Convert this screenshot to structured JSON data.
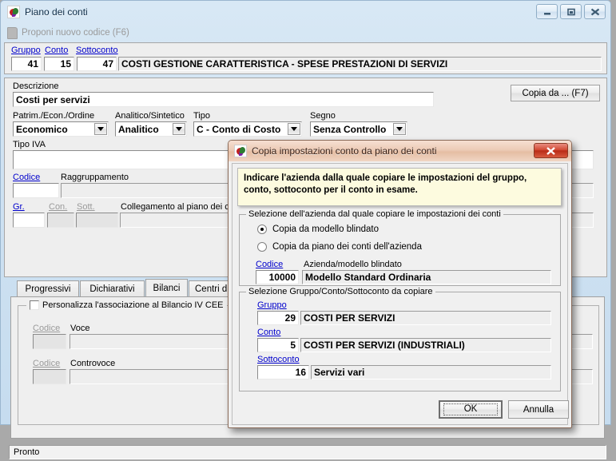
{
  "main_window": {
    "title": "Piano dei conti",
    "icon": "app-icon",
    "window_buttons": {
      "minimize": "minimize-icon",
      "maximize": "maximize-icon",
      "close": "close-icon"
    },
    "toolbar": {
      "new_code_label": "Proponi nuovo codice (F6)",
      "doc_icon": "document-icon"
    },
    "key_panel": {
      "gruppo_label": "Gruppo",
      "conto_label": "Conto",
      "sottoconto_label": "Sottoconto",
      "gruppo_value": "41",
      "conto_value": "15",
      "sottoconto_value": "47",
      "account_name": "COSTI GESTIONE CARATTERISTICA - SPESE PRESTAZIONI DI SERVIZI"
    },
    "description_panel": {
      "descrizione_label": "Descrizione",
      "descrizione_value": "Costi per servizi",
      "copia_button": "Copia da ... (F7)",
      "patrim_label": "Patrim./Econ./Ordine",
      "patrim_value": "Economico",
      "analitico_label": "Analitico/Sintetico",
      "analitico_value": "Analitico",
      "tipo_label": "Tipo",
      "tipo_value": "C - Conto di Costo",
      "segno_label": "Segno",
      "segno_value": "Senza Controllo",
      "tipo_iva_label": "Tipo IVA",
      "tipo_iva_value": "",
      "codice_label": "Codice",
      "codice_value": "",
      "raggruppamento_label": "Raggruppamento",
      "raggruppamento_value": "",
      "gr_label": "Gr.",
      "con_label": "Con.",
      "sott_label": "Sott.",
      "gr_value": "",
      "con_value": "",
      "sott_value": "",
      "collegamento_label": "Collegamento al piano dei conti",
      "collegamento_value": ""
    },
    "tabs": [
      {
        "label": "Progressivi",
        "active": false
      },
      {
        "label": "Dichiarativi",
        "active": false
      },
      {
        "label": "Bilanci",
        "active": true
      },
      {
        "label": "Centri di costo/ric",
        "active": false
      }
    ],
    "tab_panel": {
      "group_title": "Personalizza l'associazione al Bilancio IV CEE",
      "checkbox_checked": false,
      "codice_label_1": "Codice",
      "voce_label": "Voce",
      "codice_value_1": "",
      "voce_value": "",
      "codice_label_2": "Codice",
      "controvoce_label": "Controvoce",
      "codice_value_2": "",
      "controvoce_value": ""
    },
    "statusbar": {
      "text": "Pronto"
    }
  },
  "dialog": {
    "title": "Copia impostazioni conto da piano dei conti",
    "icon": "app-icon",
    "close_button": "close-icon",
    "info_text": "Indicare l'azienda dalla quale copiare le impostazioni del gruppo, conto, sottoconto per il conto in esame.",
    "company_group": {
      "title": "Selezione dell'azienda dal quale copiare le impostazioni dei conti",
      "radio_options": [
        {
          "label": "Copia da modello blindato",
          "selected": true
        },
        {
          "label": "Copia da piano dei conti dell'azienda",
          "selected": false
        }
      ],
      "codice_label": "Codice",
      "azienda_label": "Azienda/modello blindato",
      "codice_value": "10000",
      "azienda_value": "Modello Standard Ordinaria"
    },
    "account_group": {
      "title": "Selezione Gruppo/Conto/Sottoconto da copiare",
      "rows": [
        {
          "label": "Gruppo",
          "code": "29",
          "description": "COSTI PER SERVIZI"
        },
        {
          "label": "Conto",
          "code": "5",
          "description": "COSTI PER SERVIZI (INDUSTRIALI)"
        },
        {
          "label": "Sottoconto",
          "code": "16",
          "description": "Servizi vari"
        }
      ]
    },
    "buttons": {
      "ok": "OK",
      "cancel": "Annulla"
    }
  },
  "colors": {
    "main_titlebar": "#d8e8f5",
    "dialog_titlebar": "#eccbb6",
    "link": "#0000cc",
    "info_background": "#fdfbdf",
    "close_button": "#b92c17"
  }
}
